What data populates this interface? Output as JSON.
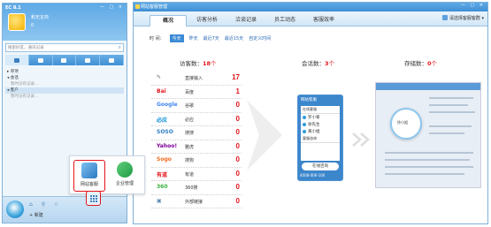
{
  "left_panel": {
    "title": "EC 8.1",
    "window_buttons": "— ▢ ×",
    "username": "和无言商",
    "coin": "0",
    "search_placeholder": "搜索好友，通讯记录",
    "groups": [
      {
        "label": "▸ 单项",
        "sub": ""
      },
      {
        "label": "◂ 会话",
        "sub": "暂时没有记录..."
      },
      {
        "label": "◂ 客户",
        "sub": "暂时没有记录..."
      }
    ],
    "bottom_new_label": "+ 新建",
    "mini_icons": "⌂ ⚲ ☆"
  },
  "popup": {
    "item1_label": "网站客服",
    "item2_label": "企业管理"
  },
  "right_window": {
    "title": "网站客服管理",
    "window_buttons": "— ▢ ×",
    "tabs": [
      "概况",
      "访客分析",
      "洽谈记录",
      "员工动态",
      "客服效率"
    ],
    "select_label": "请选择客服客群 ▾",
    "time_label": "时 间：",
    "time_options": [
      "今天",
      "昨天",
      "最近7天",
      "最近15天",
      "自定义时间"
    ],
    "visitors_label": "访客数：",
    "visitors_count": "18",
    "visitors_unit": "个",
    "sessions_label": "会话数：",
    "sessions_count": "3",
    "sessions_unit": "个",
    "storage_label": "存储数：",
    "storage_count": "0",
    "storage_unit": "个"
  },
  "visitors": [
    {
      "logo": "✎",
      "name": "直接输入",
      "count": "17",
      "color": "#666666"
    },
    {
      "logo": "Bai",
      "name": "百度",
      "count": "1",
      "color": "#e3141c"
    },
    {
      "logo": "Google",
      "name": "谷歌",
      "count": "0",
      "color": "#4285f4"
    },
    {
      "logo": "必应",
      "name": "必应",
      "count": "0",
      "color": "#0c8fd4"
    },
    {
      "logo": "SOSO",
      "name": "搜搜",
      "count": "0",
      "color": "#2f7dc3"
    },
    {
      "logo": "Yahoo!",
      "name": "雅虎",
      "count": "0",
      "color": "#7b0099"
    },
    {
      "logo": "Sogo",
      "name": "搜狗",
      "count": "0",
      "color": "#f36c21"
    },
    {
      "logo": "有道",
      "name": "有道",
      "count": "0",
      "color": "#e3141c"
    },
    {
      "logo": "360",
      "name": "360搜",
      "count": "0",
      "color": "#3cb03c"
    },
    {
      "logo": "▣",
      "name": "外部链接",
      "count": "0",
      "color": "#5a8bb8"
    }
  ],
  "widget": {
    "header": "网站客服",
    "subheader": "在线客服",
    "persons": [
      "罗小菊",
      "徐先生",
      "黄小姐"
    ],
    "extra": "客服咨询",
    "button": "在线咨询",
    "phone": "4008-006-100"
  },
  "screenshot": {
    "bubble_text": "徐小姐"
  }
}
